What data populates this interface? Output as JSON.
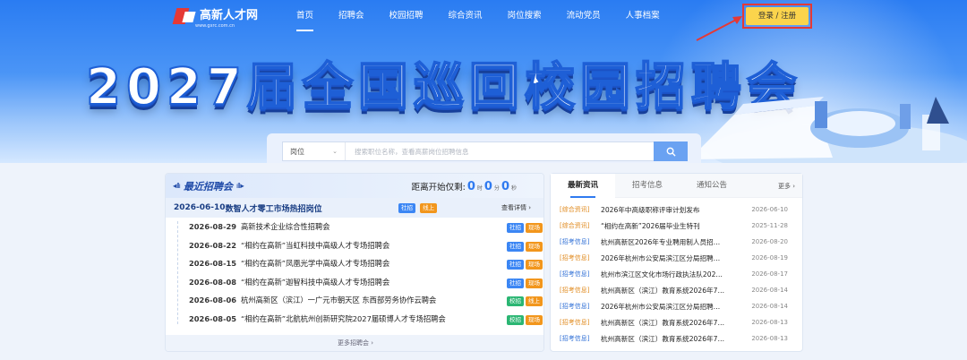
{
  "header": {
    "logo_text": "高新人才网",
    "logo_sub": "www.gxrc.com.cn",
    "nav": [
      "首页",
      "招聘会",
      "校园招聘",
      "综合资讯",
      "岗位搜索",
      "流动党员",
      "人事档案"
    ],
    "login_label": "登录 / 注册"
  },
  "banner": {
    "title": "2027届全国巡回校园招聘会"
  },
  "search": {
    "type": "岗位",
    "placeholder": "搜索职位名称，查看高薪岗位招聘信息"
  },
  "recent": {
    "title": "最近招聘会",
    "countdown_label": "距离开始仅剩:",
    "countdown": {
      "hours": "0",
      "hours_unit": "时",
      "minutes": "0",
      "minutes_unit": "分",
      "seconds": "0",
      "seconds_unit": "秒"
    },
    "featured": {
      "date": "2026-06-10",
      "title": "数智人才零工市场热招岗位",
      "tags": [
        "社招",
        "线上"
      ],
      "more": "查看详情"
    },
    "rows": [
      {
        "date": "2026-08-29",
        "name": "高新技术企业综合性招聘会",
        "tags": [
          "社招",
          "现场"
        ]
      },
      {
        "date": "2026-08-22",
        "name": "“相约在高新”当虹科技中高级人才专场招聘会",
        "tags": [
          "社招",
          "现场"
        ]
      },
      {
        "date": "2026-08-15",
        "name": "“相约在高新”凤凰光学中高级人才专场招聘会",
        "tags": [
          "社招",
          "现场"
        ]
      },
      {
        "date": "2026-08-08",
        "name": "“相约在高新”迦智科技中高级人才专场招聘会",
        "tags": [
          "社招",
          "现场"
        ]
      },
      {
        "date": "2026-08-06",
        "name": "杭州高新区（滨江）一广元市朝天区 东西部劳务协作云聘会",
        "tags": [
          "校招",
          "线上"
        ]
      },
      {
        "date": "2026-08-05",
        "name": "“相约在高新”北航杭州创新研究院2027届硕博人才专场招聘会",
        "tags": [
          "校招",
          "现场"
        ]
      }
    ],
    "more": "更多招聘会"
  },
  "news": {
    "tabs": [
      "最新资讯",
      "招考信息",
      "通知公告"
    ],
    "more": "更多",
    "items": [
      {
        "cat": "[综合资讯]",
        "title": "2026年中高级职称评审计划发布",
        "date": "2026-06-10",
        "color": "#e08a1e"
      },
      {
        "cat": "[综合资讯]",
        "title": "“相约在高新”2026届毕业生特刊",
        "date": "2025-11-28",
        "color": "#e08a1e"
      },
      {
        "cat": "[招考信息]",
        "title": "杭州高新区2026年专业聘用制人员招…",
        "date": "2026-08-20",
        "color": "#2f6fd6"
      },
      {
        "cat": "[招考信息]",
        "title": "2026年杭州市公安局滨江区分局招聘…",
        "date": "2026-08-19",
        "color": "#e08a1e"
      },
      {
        "cat": "[招考信息]",
        "title": "杭州市滨江区文化市场行政执法队202…",
        "date": "2026-08-17",
        "color": "#2f6fd6"
      },
      {
        "cat": "[招考信息]",
        "title": "杭州高新区（滨江）教育系统2026年7…",
        "date": "2026-08-14",
        "color": "#e08a1e"
      },
      {
        "cat": "[招考信息]",
        "title": "2026年杭州市公安局滨江区分局招聘…",
        "date": "2026-08-14",
        "color": "#2f6fd6"
      },
      {
        "cat": "[招考信息]",
        "title": "杭州高新区（滨江）教育系统2026年7…",
        "date": "2026-08-13",
        "color": "#e08a1e"
      },
      {
        "cat": "[招考信息]",
        "title": "杭州高新区（滨江）教育系统2026年7…",
        "date": "2026-08-13",
        "color": "#2f6fd6"
      }
    ]
  }
}
